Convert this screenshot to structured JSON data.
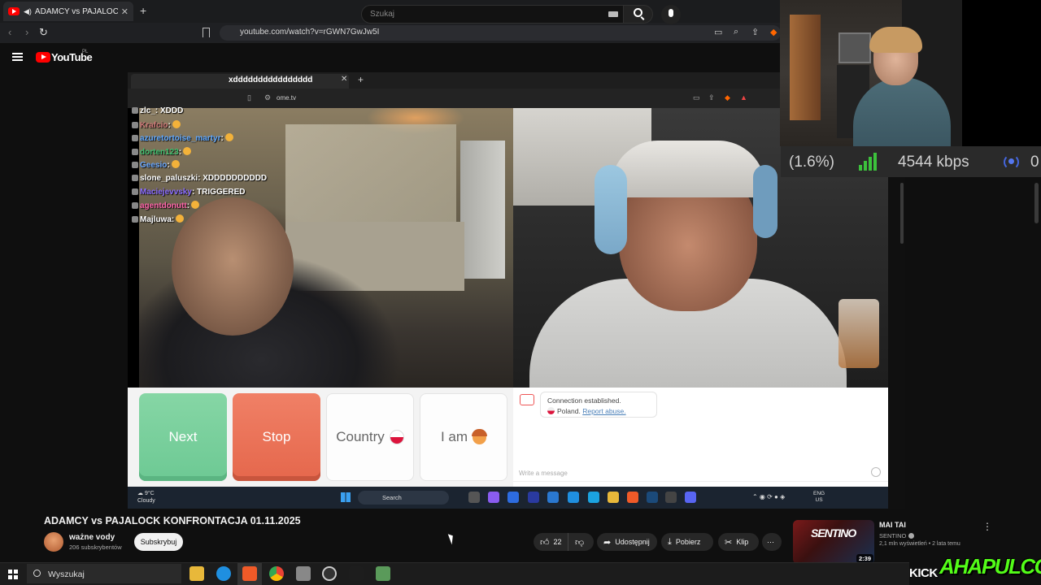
{
  "browser": {
    "tab_title": "ADAMCY vs PAJALOCK KONF",
    "url": "youtube.com/watch?v=rGWN7GwJw5I"
  },
  "youtube": {
    "logo": "YouTube",
    "region": "PL",
    "search_placeholder": "Szukaj"
  },
  "stream": {
    "inner_tab_title": "xdddddddddddddddd",
    "inner_url": "ome.tv",
    "chat": [
      {
        "user": "zlc_",
        "msg": ": XDDD",
        "color": "#ffffff"
      },
      {
        "user": "Krafcio",
        "msg": ":",
        "color": "#c77"
      },
      {
        "user": "azuretortoise_martyr",
        "msg": ":",
        "color": "#5fa8ff"
      },
      {
        "user": "dorten123",
        "msg": ":",
        "color": "#40c070"
      },
      {
        "user": "Geesio",
        "msg": ":",
        "color": "#6aa8ff"
      },
      {
        "user": "slone_paluszki",
        "msg": ": XDDDDDDDDDD",
        "color": "#ffffff"
      },
      {
        "user": "Maciejevvsky",
        "msg": ": TRIGGERED",
        "color": "#8a6cff"
      },
      {
        "user": "agentdonutt",
        "msg": ":",
        "color": "#ff66aa"
      },
      {
        "user": "Majluwa",
        "msg": ":",
        "color": "#ffffff"
      }
    ],
    "buttons": {
      "next": "Next",
      "stop": "Stop",
      "country": "Country",
      "iam": "I am"
    },
    "ome_chat": {
      "established": "Connection established.",
      "country": "Poland.",
      "report": "Report abuse.",
      "input_placeholder": "Write a message"
    },
    "inner_taskbar": {
      "temp": "9°C",
      "weather": "Cloudy",
      "search": "Search",
      "lang1": "ENG",
      "lang2": "US"
    }
  },
  "overlay": {
    "drop_pct": "(1.6%)",
    "bitrate": "4544 kbps",
    "viewers": "0",
    "kick": "KICK",
    "streamer": "AHAPULCO"
  },
  "video": {
    "title": "ADAMCY vs PAJALOCK KONFRONTACJA 01.11.2025",
    "channel": "ważne vody",
    "subscribers": "206 subskrybentów",
    "subscribe": "Subskrybuj",
    "likes": "22",
    "share": "Udostępnij",
    "download": "Pobierz",
    "clip": "Klip"
  },
  "recommendation": {
    "title": "MAI TAI",
    "channel": "SENTINO",
    "meta": "2,1 mln wyświetleń • 2 lata temu",
    "duration": "2:39",
    "thumb_text": "SENTINO"
  },
  "taskbar": {
    "search_placeholder": "Wyszukaj"
  }
}
